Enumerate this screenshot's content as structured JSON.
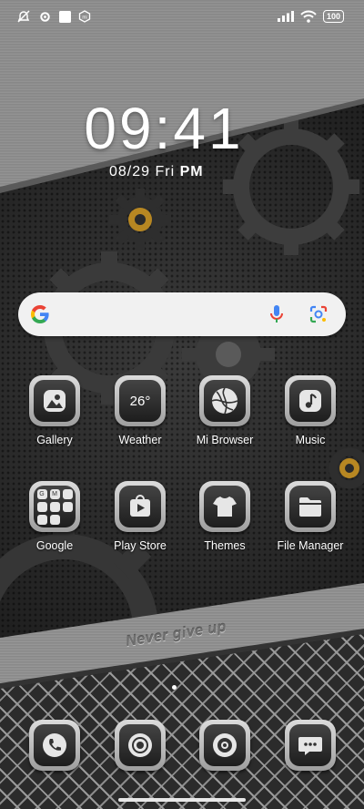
{
  "status_bar": {
    "left_icons": [
      "no-notification-icon",
      "settings-icon",
      "square-icon",
      "mi-icon"
    ],
    "battery": "100",
    "right_icons": [
      "signal-icon",
      "wifi-icon",
      "battery-icon"
    ]
  },
  "clock": {
    "time": "09:41",
    "date": "08/29",
    "weekday": "Fri",
    "ampm": "PM"
  },
  "search": {
    "google_icon": "google-logo-icon",
    "mic_icon": "mic-icon",
    "lens_icon": "lens-icon"
  },
  "apps": [
    {
      "label": "Gallery",
      "icon": "gallery-icon"
    },
    {
      "label": "Weather",
      "icon": "weather-icon",
      "value": "26°"
    },
    {
      "label": "Mi Browser",
      "icon": "browser-icon"
    },
    {
      "label": "Music",
      "icon": "music-icon"
    },
    {
      "label": "Google",
      "icon": "google-folder-icon"
    },
    {
      "label": "Play Store",
      "icon": "play-store-icon"
    },
    {
      "label": "Themes",
      "icon": "themes-icon"
    },
    {
      "label": "File Manager",
      "icon": "file-manager-icon"
    }
  ],
  "dock": [
    {
      "icon": "phone-icon"
    },
    {
      "icon": "chrome-icon"
    },
    {
      "icon": "camera-icon"
    },
    {
      "icon": "messages-icon"
    }
  ],
  "wallpaper_text": "Never give up",
  "colors": {
    "accent_gear": "#b78722",
    "icon_frame": "#c8c8c8"
  }
}
